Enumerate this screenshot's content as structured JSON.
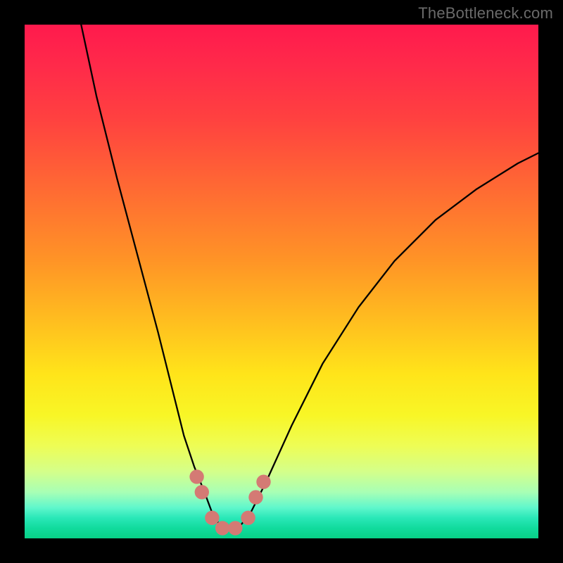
{
  "watermark": "TheBottleneck.com",
  "chart_data": {
    "type": "line",
    "title": "",
    "xlabel": "",
    "ylabel": "",
    "xlim": [
      0,
      100
    ],
    "ylim": [
      0,
      100
    ],
    "grid": false,
    "legend": false,
    "background_gradient": {
      "direction": "vertical",
      "stops": [
        {
          "pos": 0.0,
          "color": "#ff1a4d"
        },
        {
          "pos": 0.3,
          "color": "#ff6a33"
        },
        {
          "pos": 0.6,
          "color": "#ffe41a"
        },
        {
          "pos": 0.85,
          "color": "#d4ff8a"
        },
        {
          "pos": 1.0,
          "color": "#08d187"
        }
      ]
    },
    "series": [
      {
        "name": "bottleneck-curve",
        "color": "#000000",
        "x": [
          11,
          14,
          18,
          22,
          26,
          29,
          31,
          33,
          35,
          36.5,
          38,
          40,
          42,
          44,
          47,
          52,
          58,
          65,
          72,
          80,
          88,
          96,
          100
        ],
        "y": [
          100,
          86,
          70,
          55,
          40,
          28,
          20,
          14,
          9,
          5,
          2.5,
          1.5,
          2.5,
          5,
          11,
          22,
          34,
          45,
          54,
          62,
          68,
          73,
          75
        ]
      }
    ],
    "markers": {
      "name": "highlight-dots",
      "color": "#d47a74",
      "radius_norm": 1.4,
      "points": [
        {
          "x": 33.5,
          "y": 12
        },
        {
          "x": 34.5,
          "y": 9
        },
        {
          "x": 36.5,
          "y": 4
        },
        {
          "x": 38.5,
          "y": 2
        },
        {
          "x": 41.0,
          "y": 2
        },
        {
          "x": 43.5,
          "y": 4
        },
        {
          "x": 45.0,
          "y": 8
        },
        {
          "x": 46.5,
          "y": 11
        }
      ]
    }
  }
}
